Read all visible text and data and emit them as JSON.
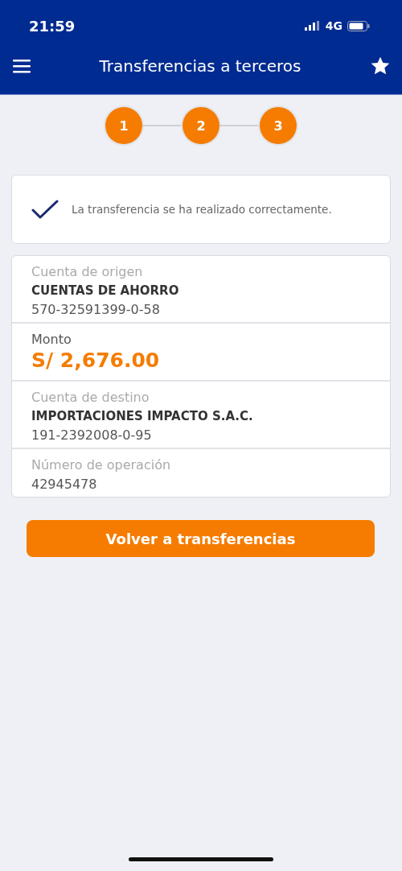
{
  "status_bar": {
    "time": "21:59",
    "network": "4G"
  },
  "header": {
    "title": "Transferencias a terceros"
  },
  "steps": [
    {
      "label": "1",
      "done": true
    },
    {
      "label": "2",
      "done": true
    },
    {
      "label": "3",
      "done": true
    }
  ],
  "message": {
    "text": "La transferencia se ha realizado correctamente."
  },
  "details": [
    {
      "label": "Cuenta de origen",
      "values": [
        {
          "kind": "name",
          "text": "CUENTAS DE AHORRO"
        },
        {
          "kind": "plain",
          "text": "570-32591399-0-58"
        }
      ]
    },
    {
      "label": "Monto",
      "values": [
        {
          "kind": "amount",
          "text": "S/ 2,676.00"
        }
      ]
    },
    {
      "label": "Cuenta de destino",
      "values": [
        {
          "kind": "name",
          "text": "IMPORTACIONES IMPACTO S.A.C."
        },
        {
          "kind": "plain",
          "text": "191-2392008-0-95"
        }
      ]
    },
    {
      "label": "Número de operación",
      "values": [
        {
          "kind": "plain",
          "text": "42945478"
        }
      ]
    }
  ],
  "button": {
    "label": "Volver a transferencias"
  }
}
